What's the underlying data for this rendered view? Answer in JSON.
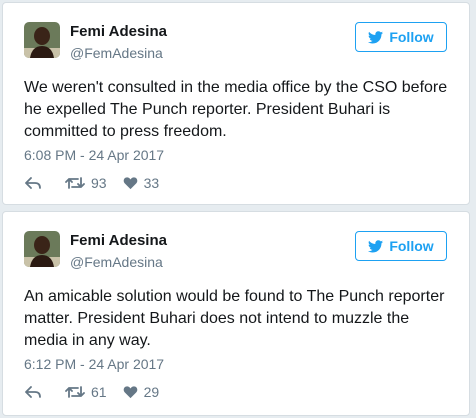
{
  "colors": {
    "accent": "#1da1f2",
    "secondary_text": "#657786",
    "primary_text": "#14171a",
    "background": "#e6ecf0"
  },
  "tweets": [
    {
      "author_name": "Femi Adesina",
      "handle": "@FemAdesina",
      "follow_label": "Follow",
      "text": "We weren't consulted in the media office by the CSO before he expelled The Punch reporter. President Buhari is committed to press freedom.",
      "timestamp": "6:08 PM - 24 Apr 2017",
      "retweets": "93",
      "likes": "33"
    },
    {
      "author_name": "Femi Adesina",
      "handle": "@FemAdesina",
      "follow_label": "Follow",
      "text": "An amicable solution would be found to The Punch reporter matter. President Buhari does not intend to muzzle the media in any way.",
      "timestamp": "6:12 PM - 24 Apr 2017",
      "retweets": "61",
      "likes": "29"
    }
  ],
  "icons": [
    "avatar",
    "twitter-bird-icon",
    "reply-icon",
    "retweet-icon",
    "heart-icon"
  ]
}
